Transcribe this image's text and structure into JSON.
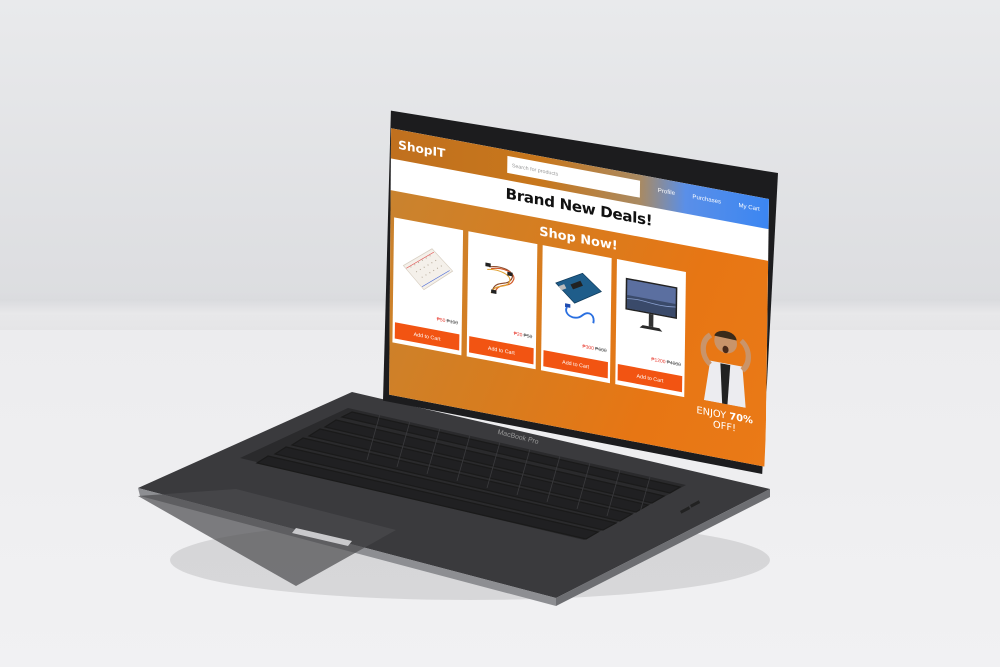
{
  "app": {
    "brand": "ShopIT",
    "search_placeholder": "Search for products"
  },
  "nav": {
    "links": [
      "Profile",
      "Purchases",
      "My Cart"
    ]
  },
  "headline": "Brand New Deals!",
  "deals": {
    "banner": "Shop Now!",
    "products": [
      {
        "name": "Breadboard",
        "price": "₱50",
        "old_price": "₱100",
        "button": "Add to Cart"
      },
      {
        "name": "Jumper wires",
        "price": "₱20",
        "old_price": "₱50",
        "button": "Add to Cart"
      },
      {
        "name": "Arduino board with USB cable",
        "price": "₱300",
        "old_price": "₱600",
        "button": "Add to Cart"
      },
      {
        "name": "Monitor",
        "price": "₱1200",
        "old_price": "₱4000",
        "button": "Add to Cart"
      }
    ],
    "promo_text_1": "ENJOY ",
    "promo_text_2": "70%",
    "promo_text_3": " OFF!"
  },
  "laptop": {
    "model_label": "MacBook Pro"
  },
  "colors": {
    "navbar_orange": "#c8771c",
    "navbar_blue": "#3b86f2",
    "deals_orange": "#e77614",
    "button_red": "#f25412",
    "price_red": "#e83a2e"
  }
}
